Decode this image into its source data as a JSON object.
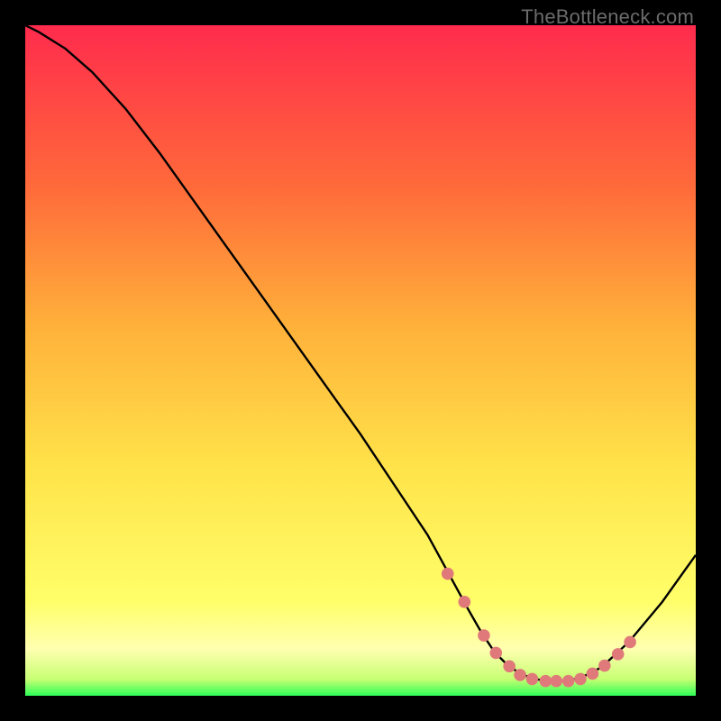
{
  "attribution": "TheBottleneck.com",
  "colors": {
    "bg": "#000000",
    "gradient_top": "#ff2b4d",
    "gradient_mid_upper": "#ff6a3a",
    "gradient_mid": "#ffb13a",
    "gradient_mid_lower": "#ffe34a",
    "gradient_lower": "#ffff6a",
    "gradient_bottom": "#2dff57",
    "curve": "#000000",
    "marker": "#e07a7a"
  },
  "chart_data": {
    "type": "line",
    "title": "",
    "xlabel": "",
    "ylabel": "",
    "xlim": [
      0,
      100
    ],
    "ylim": [
      0,
      100
    ],
    "series": [
      {
        "name": "bottleneck-curve",
        "x": [
          0,
          2,
          6,
          10,
          15,
          20,
          25,
          30,
          35,
          40,
          45,
          50,
          55,
          60,
          63,
          66,
          68,
          70,
          72,
          74,
          76,
          78,
          80,
          82,
          84,
          86,
          90,
          95,
          100
        ],
        "y": [
          100,
          99,
          96.5,
          93,
          87.5,
          81,
          74,
          67,
          60,
          53,
          46,
          39,
          31.5,
          24,
          18.5,
          13,
          9.5,
          6.5,
          4.5,
          3.2,
          2.5,
          2.2,
          2.2,
          2.5,
          3.2,
          4.3,
          8,
          14,
          21
        ]
      }
    ],
    "markers": {
      "name": "highlight-points",
      "x": [
        63,
        65.5,
        68.4,
        70.2,
        72.2,
        73.8,
        75.6,
        77.6,
        79.2,
        81,
        82.8,
        84.6,
        86.4,
        88.4,
        90.2
      ],
      "y": [
        18.2,
        14,
        9,
        6.4,
        4.4,
        3.1,
        2.5,
        2.2,
        2.2,
        2.2,
        2.5,
        3.3,
        4.5,
        6.2,
        8
      ]
    }
  }
}
